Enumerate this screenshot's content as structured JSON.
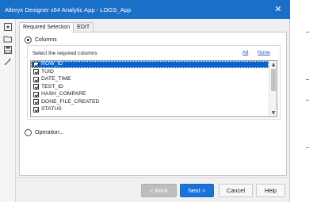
{
  "window": {
    "title": "Alteryx Designer x64 Analytic App - LOGS_App",
    "close_glyph": "✕"
  },
  "sidebar": {
    "icons": [
      "app-icon",
      "folder-open-icon",
      "save-icon",
      "magic-wand-icon"
    ]
  },
  "tabs": [
    {
      "label": "Required Selection",
      "active": true
    },
    {
      "label": "EDIT",
      "active": false
    }
  ],
  "columns_option": {
    "label": "Columns",
    "selected": true,
    "group_title": "Select the required columns",
    "all_link": "All",
    "none_link": "None",
    "items": [
      {
        "label": "ROW_ID",
        "checked": true,
        "selected": true
      },
      {
        "label": "TUID",
        "checked": true,
        "selected": false
      },
      {
        "label": "DATE_TIME",
        "checked": true,
        "selected": false
      },
      {
        "label": "TEST_ID",
        "checked": true,
        "selected": false
      },
      {
        "label": "HASH_COMPARE",
        "checked": true,
        "selected": false
      },
      {
        "label": "DONE_FILE_CREATED",
        "checked": true,
        "selected": false
      },
      {
        "label": "STATUS",
        "checked": true,
        "selected": false
      }
    ]
  },
  "operation_option": {
    "label": "Operation...",
    "selected": false
  },
  "buttons": {
    "back": "< Back",
    "next": "Next >",
    "cancel": "Cancel",
    "help": "Help"
  },
  "colors": {
    "titlebar": "#1a6fc9",
    "selection": "#0a64d2",
    "primary_button": "#1a73d9"
  }
}
